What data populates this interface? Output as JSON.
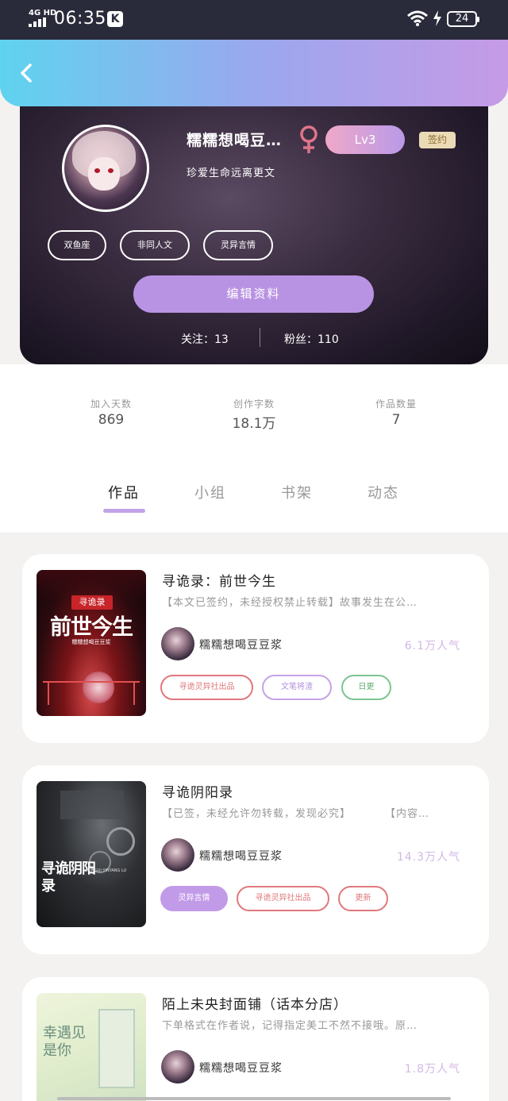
{
  "status_bar": {
    "network": "4G HD",
    "time": "06:35",
    "app_badge": "K",
    "battery": "24"
  },
  "profile": {
    "username": "糯糯想喝豆…",
    "gender_icon": "female-icon",
    "level": "Lv3",
    "sign_badge": "签约",
    "motto": "珍爱生命远离更文",
    "tags": [
      "双鱼座",
      "非同人文",
      "灵异言情"
    ],
    "edit_button": "编辑资料",
    "following": "关注：13",
    "fans": "粉丝：110"
  },
  "stats": [
    {
      "label": "加入天数",
      "value": "869"
    },
    {
      "label": "创作字数",
      "value": "18.1万"
    },
    {
      "label": "作品数量",
      "value": "7"
    }
  ],
  "tabs": [
    {
      "label": "作品",
      "active": true
    },
    {
      "label": "小组",
      "active": false
    },
    {
      "label": "书架",
      "active": false
    },
    {
      "label": "动态",
      "active": false
    }
  ],
  "works": [
    {
      "title": "寻诡录：前世今生",
      "description": "【本文已签约，未经授权禁止转载】故事发生在公…",
      "author": "糯糯想喝豆豆浆",
      "popularity": "6.1万人气",
      "tags": [
        {
          "label": "寻诡灵异社出品",
          "style": "red"
        },
        {
          "label": "文笔将渣",
          "style": "purple"
        },
        {
          "label": "日更",
          "style": "green"
        }
      ],
      "cover_text": {
        "small": "寻诡录",
        "big": "前世今生",
        "author": "糯糯想喝豆豆浆"
      }
    },
    {
      "title": "寻诡阴阳录",
      "description": "【已签，未经允许勿转载，发现必究】　　　　【内容…",
      "author": "糯糯想喝豆豆浆",
      "popularity": "14.3万人气",
      "tags": [
        {
          "label": "灵异言情",
          "style": "fill"
        },
        {
          "label": "寻诡灵异社出品",
          "style": "red"
        },
        {
          "label": "更新",
          "style": "red"
        }
      ],
      "cover_text": {
        "big": "寻诡阴阳录",
        "sub": "XUNGUI YINYANG LU"
      }
    },
    {
      "title": "陌上未央封面铺（话本分店）",
      "description": "下单格式在作者说，记得指定美工不然不接哦。原…",
      "author": "糯糯想喝豆豆浆",
      "popularity": "1.8万人气",
      "tags": [],
      "cover_text": {
        "big": "幸遇见是你"
      }
    }
  ]
}
